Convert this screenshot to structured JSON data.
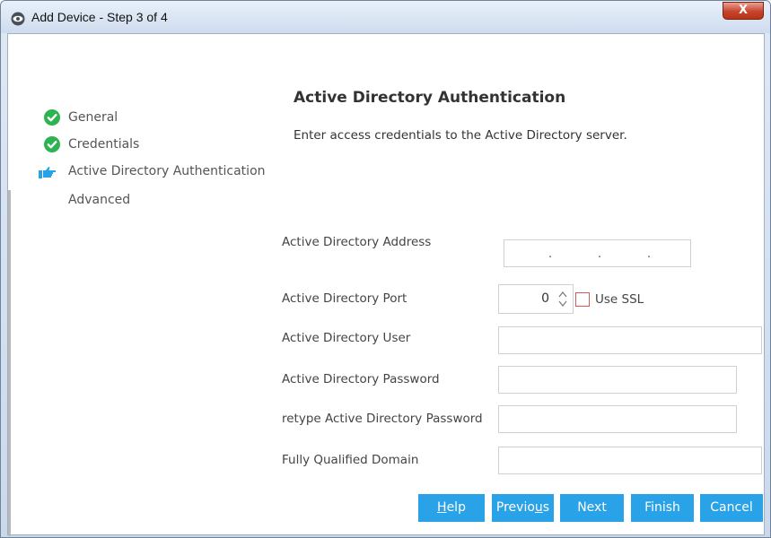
{
  "window": {
    "title": "Add Device - Step 3 of 4",
    "close_glyph": "X"
  },
  "sidebar": {
    "steps": [
      {
        "label": "General",
        "status": "complete",
        "icon": "check-circle-icon"
      },
      {
        "label": "Credentials",
        "status": "complete",
        "icon": "check-circle-icon"
      },
      {
        "label": "Active Directory Authentication",
        "status": "current",
        "icon": "pointing-hand-icon"
      },
      {
        "label": "Advanced",
        "status": "pending",
        "icon": ""
      }
    ]
  },
  "main": {
    "title": "Active Directory Authentication",
    "description": "Enter access credentials to the Active Directory server."
  },
  "form": {
    "address": {
      "label": "Active Directory Address",
      "value": ""
    },
    "port": {
      "label": "Active Directory Port",
      "value": "0"
    },
    "use_ssl": {
      "label": "Use SSL",
      "checked": false
    },
    "user": {
      "label": "Active Directory User",
      "value": ""
    },
    "password": {
      "label": "Active Directory Password",
      "value": ""
    },
    "retype_password": {
      "label": "retype Active Directory Password",
      "value": ""
    },
    "domain": {
      "label": "Fully Qualified Domain",
      "value": ""
    }
  },
  "buttons": {
    "help_mnemonic": "H",
    "help_rest": "elp",
    "previous_before": "Previo",
    "previous_mnemonic": "u",
    "previous_after": "s",
    "next": "Next",
    "finish": "Finish",
    "cancel": "Cancel"
  },
  "colors": {
    "accent": "#2aa2e8",
    "check_green": "#2db350",
    "close_red": "#c7432b"
  }
}
